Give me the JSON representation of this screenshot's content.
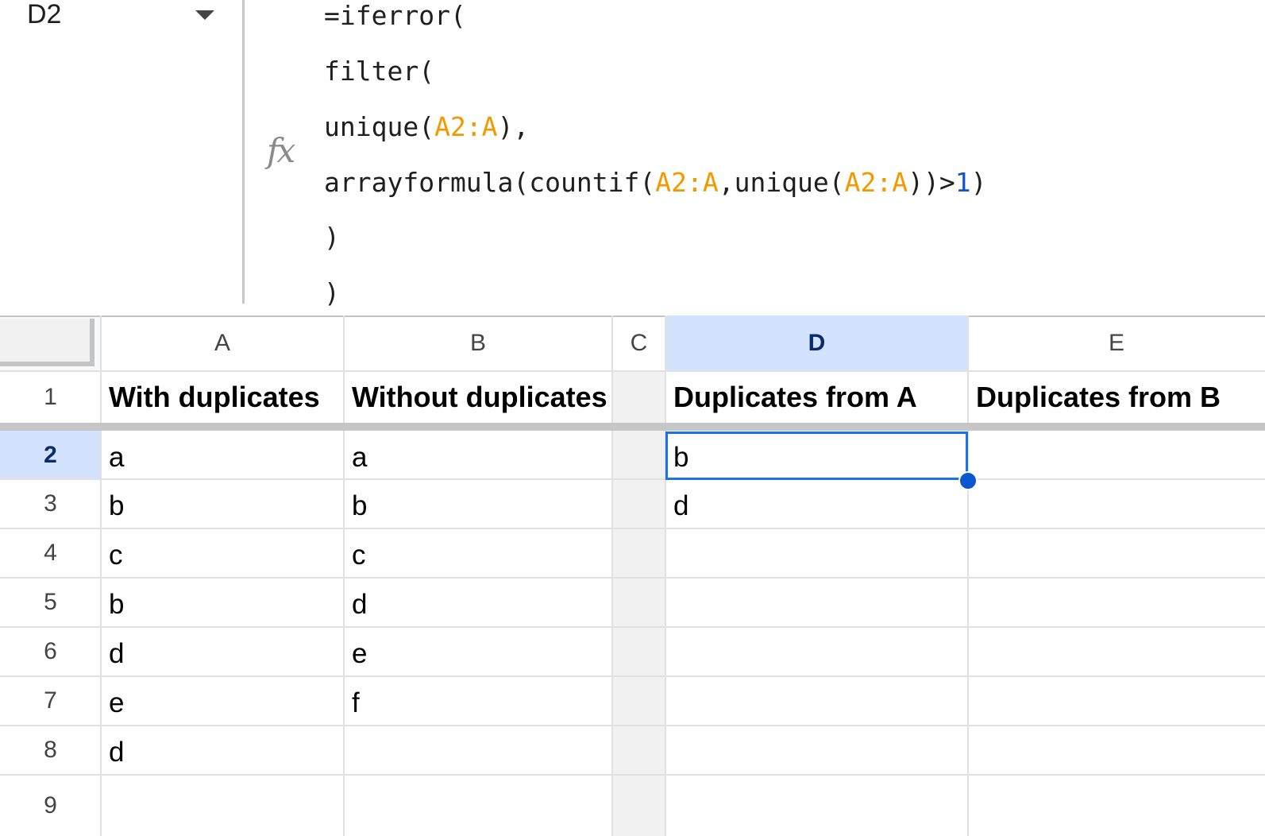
{
  "name_box": {
    "value": "D2"
  },
  "formula_bar": {
    "icon": "fx-icon",
    "icon_text": "fx",
    "lines": [
      [
        {
          "t": "=iferror(",
          "k": "plain"
        }
      ],
      [
        {
          "t": "filter(",
          "k": "plain"
        }
      ],
      [
        {
          "t": "unique(",
          "k": "plain"
        },
        {
          "t": "A2:A",
          "k": "ref"
        },
        {
          "t": "),",
          "k": "plain"
        }
      ],
      [
        {
          "t": "arrayformula(countif(",
          "k": "plain"
        },
        {
          "t": "A2:A",
          "k": "ref"
        },
        {
          "t": ",unique(",
          "k": "plain"
        },
        {
          "t": "A2:A",
          "k": "ref"
        },
        {
          "t": "))>",
          "k": "plain"
        },
        {
          "t": "1",
          "k": "num"
        },
        {
          "t": ")",
          "k": "plain"
        }
      ],
      [
        {
          "t": ")",
          "k": "plain"
        }
      ],
      [
        {
          "t": ")",
          "k": "plain"
        }
      ]
    ],
    "colors": {
      "ref": "#f29900",
      "num": "#1155cc"
    }
  },
  "sheet": {
    "columns": [
      "A",
      "B",
      "C",
      "D",
      "E"
    ],
    "selected_column": "D",
    "rows": [
      "1",
      "2",
      "3",
      "4",
      "5",
      "6",
      "7",
      "8",
      "9"
    ],
    "selected_row": "2",
    "headers": {
      "A": "With duplicates",
      "B": "Without duplicates",
      "D": "Duplicates from A",
      "E": "Duplicates from B"
    },
    "col_A": [
      "a",
      "b",
      "c",
      "b",
      "d",
      "e",
      "d"
    ],
    "col_B": [
      "a",
      "b",
      "c",
      "d",
      "e",
      "f"
    ],
    "col_D": [
      "b",
      "d"
    ],
    "active_cell": "D2",
    "selection_color": "#1a73e8",
    "header_highlight_color": "#d3e3fd"
  }
}
